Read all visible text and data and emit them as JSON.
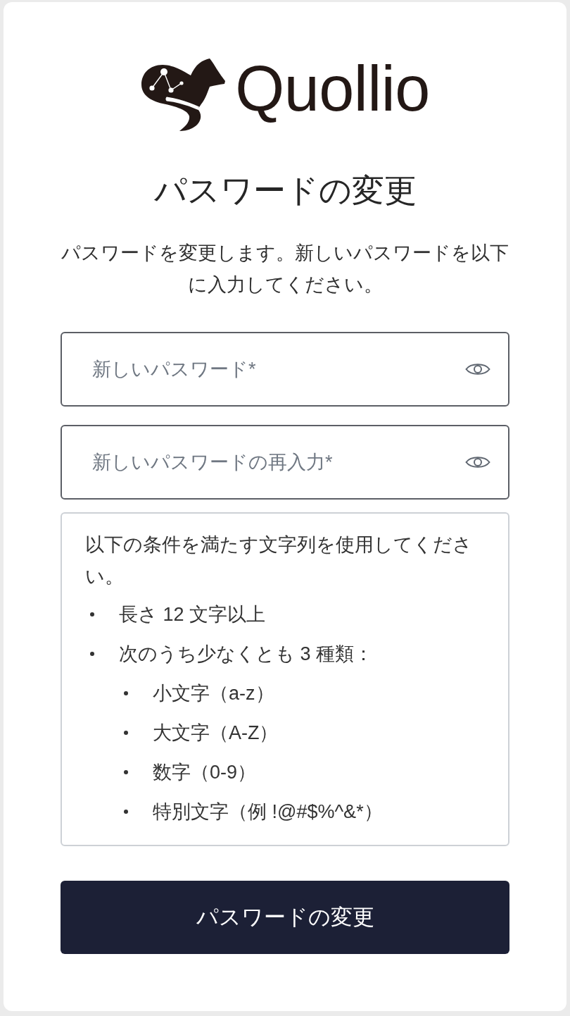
{
  "logo": {
    "wordmark": "Quollio"
  },
  "title": "パスワードの変更",
  "description": "パスワードを変更します。新しいパスワードを以下に入力してください。",
  "fields": [
    {
      "placeholder": "新しいパスワード*"
    },
    {
      "placeholder": "新しいパスワードの再入力*"
    }
  ],
  "requirements": {
    "intro": "以下の条件を満たす文字列を使用してください。",
    "items": [
      {
        "text": "長さ 12 文字以上"
      },
      {
        "text": "次のうち少なくとも 3 種類：",
        "children": [
          {
            "text": "小文字（a-z）"
          },
          {
            "text": "大文字（A-Z）"
          },
          {
            "text": "数字（0-9）"
          },
          {
            "text": "特別文字（例 !@#$%^&*）"
          }
        ]
      }
    ]
  },
  "submit_button": {
    "label": "パスワードの変更"
  }
}
